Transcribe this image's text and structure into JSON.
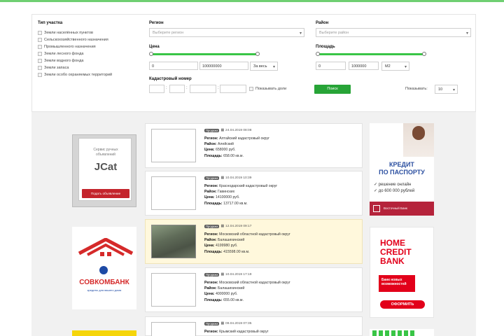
{
  "filters": {
    "type_label": "Тип участка",
    "types": [
      "Земли населённых пунктов",
      "Сельскохозяйственного назначения",
      "Промышленного назначения",
      "Земли лесного фонда",
      "Земли водного фонда",
      "Земли запаса",
      "Земли особо охраняемых территорий"
    ],
    "region_label": "Регион",
    "region_placeholder": "Выберите регион",
    "district_label": "Район",
    "district_placeholder": "Выберите район",
    "price_label": "Цена",
    "price_min": "0",
    "price_max": "100000000",
    "price_unit": "За весь",
    "area_label": "Площадь",
    "area_min": "0",
    "area_max": "1000000",
    "area_unit": "М2",
    "cadastral_label": "Кадастровый номер",
    "show_sold": "Показывать доли",
    "search_button": "Поиск",
    "per_page_label": "Показывать:",
    "per_page_value": "10"
  },
  "listings": [
    {
      "badge": "Продажа",
      "date": "24.04.2019 08:08",
      "region": "Алтайский кадастровый округ",
      "district": "Алейский",
      "price": "658000 руб.",
      "area": "658.00 кв.м."
    },
    {
      "badge": "Продажа",
      "date": "10.04.2019 10:39",
      "region": "Краснодарский кадастровый округ",
      "district": "Гавинских",
      "price": "14100000 руб.",
      "area": "13717.00 кв.м."
    },
    {
      "badge": "Продажа",
      "date": "12.04.2019 09:17",
      "region": "Московский областной кадастровый округ",
      "district": "Балашихинский",
      "price": "4199980 руб.",
      "area": "415598.00 кв.м."
    },
    {
      "badge": "Продажа",
      "date": "10.04.2019 17:19",
      "region": "Московский областной кадастровый округ",
      "district": "Балашихинский",
      "price": "4000000 руб.",
      "area": "655.00 кв.м."
    },
    {
      "badge": "Продажа",
      "date": "09.04.2019 07:35",
      "region": "Крымский кадастровый округ",
      "district": "",
      "price": "",
      "area": ""
    }
  ],
  "labels": {
    "region": "Регион:",
    "district": "Район:",
    "price": "Цена:",
    "area": "Площадь:"
  },
  "ads": {
    "jcat_line1": "Сервис ручных",
    "jcat_line2": "объявлений",
    "jcat_logo": "JCat",
    "jcat_button": "Подать объявление",
    "credit_title1": "КРЕДИТ",
    "credit_title2": "ПО ПАСПОРТУ",
    "credit_b1": "✓ решение онлайн",
    "credit_b2": "✓ до 600 000 рублей",
    "credit_bank": "Восточный Банк",
    "sovcom_name": "СОВКОМБАНК",
    "sovcom_tag": "кредиты для вашего дома",
    "home1": "HOME",
    "home2": "CREDIT",
    "home3": "BANK",
    "home_box": "Банк новых возможностей",
    "home_button": "ОФОРМИТЬ"
  }
}
